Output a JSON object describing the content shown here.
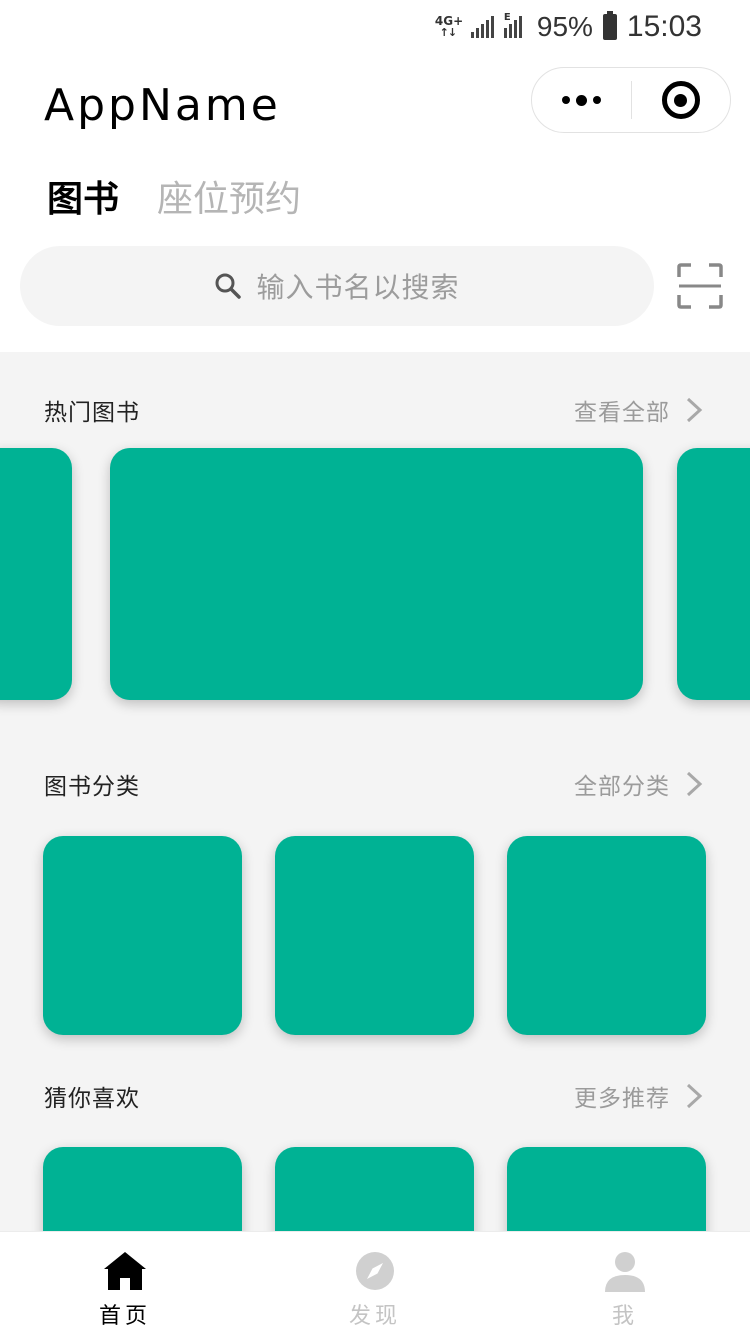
{
  "status_bar": {
    "network": "4G+",
    "network_arrows": "↑↓",
    "data_mark": "E",
    "battery": "95%",
    "time": "15:03"
  },
  "nav": {
    "title": "AppName"
  },
  "tabs": [
    {
      "label": "图书",
      "active": true
    },
    {
      "label": "座位预约",
      "active": false
    }
  ],
  "search": {
    "placeholder": "输入书名以搜索"
  },
  "sections": {
    "hot": {
      "title": "热门图书",
      "more": "查看全部"
    },
    "categories": {
      "title": "图书分类",
      "more": "全部分类"
    },
    "recommend": {
      "title": "猜你喜欢",
      "more": "更多推荐"
    }
  },
  "colors": {
    "card": "#00b294",
    "background": "#f4f4f4"
  },
  "tabbar": [
    {
      "label": "首页",
      "icon": "home-icon",
      "active": true
    },
    {
      "label": "发现",
      "icon": "compass-icon",
      "active": false
    },
    {
      "label": "我",
      "icon": "user-icon",
      "active": false
    }
  ]
}
